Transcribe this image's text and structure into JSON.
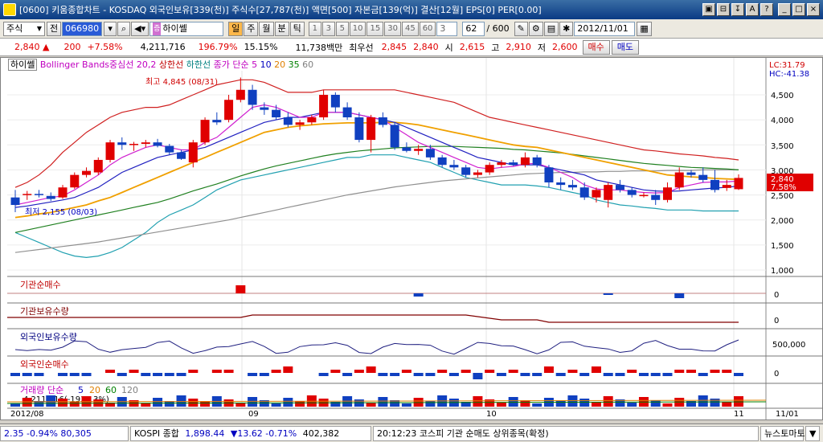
{
  "window": {
    "title": "[0600] 키움종합차트 - KOSDAQ 외국인보유[339(천)] 주식수[27,787(천)] 액면[500] 자본금[139(억)] 결산[12월] EPS[0] PER[0.00]"
  },
  "toolbar": {
    "market": "주식",
    "market_scope": "전",
    "code": "066980",
    "stock_name": "하이쎌",
    "period_buttons": [
      "일",
      "주",
      "월",
      "분",
      "틱"
    ],
    "active_period": "일",
    "minute_buttons": [
      "1",
      "3",
      "5",
      "10",
      "15",
      "30",
      "45",
      "60"
    ],
    "spin_value": "3",
    "count_value": "62",
    "count_total": "/ 600",
    "date": "2012/11/01"
  },
  "quote": {
    "price": "2,840",
    "change": "200",
    "change_pct": "+7.58%",
    "volume": "4,211,716",
    "volume_ratio": "196.79%",
    "turnover": "15.15%",
    "amount": "11,738백만",
    "best_label": "최우선",
    "ask": "2,845",
    "bid": "2,840",
    "open_label": "시",
    "open": "2,615",
    "high_label": "고",
    "high": "2,910",
    "low_label": "저",
    "low": "2,600",
    "sell_button": "매수",
    "buy_button": "매도"
  },
  "legend": {
    "name": "하이쎌",
    "bb": "Bollinger Bands중심선 20,2",
    "upper": "상한선",
    "lower": "하한선",
    "ma_title": "종가 단순",
    "ma_periods": [
      "5",
      "10",
      "20",
      "35",
      "60"
    ]
  },
  "main_chart": {
    "lc_label": "LC:31.79",
    "hc_label": "HC:-41.38",
    "high_note": "최고 4,845 (08/31)",
    "low_note": "최저 2,155 (08/03)",
    "current_price_tag": "2,840",
    "current_pct_tag": "7.58%",
    "y_ticks": [
      "4,500",
      "4,000",
      "3,500",
      "3,000",
      "2,500",
      "2,000",
      "1,500",
      "1,000"
    ]
  },
  "panels": [
    {
      "title": "기관순매수",
      "tick": "0"
    },
    {
      "title": "기관보유수량",
      "tick": "0"
    },
    {
      "title": "외국인보유수량",
      "tick": "500,000"
    },
    {
      "title": "외국인순매수",
      "tick": "0"
    },
    {
      "title": "거래량 단순",
      "periods": [
        "5",
        "20",
        "60",
        "120"
      ],
      "sub": "4,211,716(-193.13%)"
    }
  ],
  "x_axis": [
    "2012/08",
    "09",
    "10",
    "11",
    "11/01"
  ],
  "chart_data": {
    "type": "candlestick",
    "days": 62,
    "ohlc": [
      [
        2450,
        2600,
        2155,
        2300
      ],
      [
        2500,
        2580,
        2400,
        2520
      ],
      [
        2520,
        2600,
        2450,
        2500
      ],
      [
        2480,
        2550,
        2380,
        2420
      ],
      [
        2450,
        2700,
        2420,
        2650
      ],
      [
        2650,
        2950,
        2620,
        2900
      ],
      [
        2900,
        3050,
        2850,
        2980
      ],
      [
        2950,
        3250,
        2900,
        3200
      ],
      [
        3200,
        3600,
        3150,
        3550
      ],
      [
        3550,
        3650,
        3400,
        3500
      ],
      [
        3500,
        3560,
        3380,
        3520
      ],
      [
        3520,
        3600,
        3450,
        3550
      ],
      [
        3550,
        3620,
        3450,
        3480
      ],
      [
        3480,
        3520,
        3300,
        3350
      ],
      [
        3350,
        3400,
        3200,
        3220
      ],
      [
        3150,
        3600,
        3050,
        3550
      ],
      [
        3550,
        4050,
        3500,
        4000
      ],
      [
        4000,
        4150,
        3900,
        3950
      ],
      [
        4000,
        4500,
        3950,
        4400
      ],
      [
        4400,
        4845,
        4350,
        4600
      ],
      [
        4600,
        4700,
        4200,
        4300
      ],
      [
        4250,
        4350,
        4100,
        4200
      ],
      [
        4200,
        4300,
        4000,
        4050
      ],
      [
        4050,
        4150,
        3850,
        3900
      ],
      [
        3900,
        4000,
        3800,
        3950
      ],
      [
        3950,
        4100,
        3900,
        4050
      ],
      [
        4050,
        4600,
        4000,
        4500
      ],
      [
        4500,
        4550,
        4150,
        4250
      ],
      [
        4250,
        4350,
        4000,
        4050
      ],
      [
        4050,
        4150,
        3550,
        3600
      ],
      [
        3600,
        4100,
        3350,
        4050
      ],
      [
        4050,
        4150,
        3850,
        3900
      ],
      [
        3900,
        3950,
        3400,
        3450
      ],
      [
        3450,
        3550,
        3350,
        3380
      ],
      [
        3380,
        3500,
        3300,
        3420
      ],
      [
        3420,
        3500,
        3200,
        3250
      ],
      [
        3250,
        3300,
        3050,
        3100
      ],
      [
        3100,
        3200,
        3000,
        3050
      ],
      [
        3050,
        3100,
        2850,
        2900
      ],
      [
        2900,
        3000,
        2850,
        2950
      ],
      [
        2950,
        3150,
        2900,
        3100
      ],
      [
        3100,
        3200,
        3050,
        3150
      ],
      [
        3150,
        3200,
        3080,
        3100
      ],
      [
        3100,
        3350,
        3050,
        3250
      ],
      [
        3250,
        3300,
        3050,
        3100
      ],
      [
        3050,
        3100,
        2650,
        2750
      ],
      [
        2750,
        2850,
        2600,
        2700
      ],
      [
        2700,
        2800,
        2600,
        2650
      ],
      [
        2650,
        2750,
        2400,
        2450
      ],
      [
        2450,
        2650,
        2350,
        2600
      ],
      [
        2400,
        2750,
        2250,
        2700
      ],
      [
        2700,
        2800,
        2550,
        2600
      ],
      [
        2600,
        2650,
        2450,
        2500
      ],
      [
        2500,
        2550,
        2450,
        2500
      ],
      [
        2500,
        2600,
        2300,
        2400
      ],
      [
        2400,
        2750,
        2350,
        2650
      ],
      [
        2650,
        3050,
        2600,
        2950
      ],
      [
        2950,
        3000,
        2850,
        2900
      ],
      [
        2900,
        3050,
        2750,
        2800
      ],
      [
        2800,
        3000,
        2550,
        2600
      ],
      [
        2640,
        2800,
        2580,
        2700
      ],
      [
        2615,
        2910,
        2600,
        2840
      ]
    ],
    "bb_upper": [
      2650,
      2750,
      2900,
      3100,
      3350,
      3550,
      3750,
      3900,
      4050,
      4150,
      4200,
      4250,
      4250,
      4300,
      4400,
      4500,
      4600,
      4700,
      4750,
      4800,
      4800,
      4750,
      4650,
      4550,
      4550,
      4550,
      4600,
      4600,
      4600,
      4600,
      4600,
      4600,
      4600,
      4550,
      4500,
      4450,
      4400,
      4350,
      4250,
      4150,
      4050,
      4000,
      3950,
      3900,
      3850,
      3800,
      3750,
      3700,
      3650,
      3600,
      3550,
      3500,
      3450,
      3400,
      3380,
      3350,
      3320,
      3300,
      3280,
      3250,
      3230,
      3200
    ],
    "bb_lower": [
      1750,
      1650,
      1550,
      1450,
      1350,
      1280,
      1250,
      1280,
      1350,
      1450,
      1600,
      1750,
      1950,
      2100,
      2200,
      2300,
      2450,
      2600,
      2700,
      2800,
      2850,
      2900,
      2950,
      3000,
      3050,
      3100,
      3150,
      3200,
      3250,
      3250,
      3300,
      3300,
      3300,
      3250,
      3200,
      3150,
      3050,
      2950,
      2850,
      2800,
      2750,
      2700,
      2700,
      2700,
      2680,
      2650,
      2600,
      2550,
      2500,
      2400,
      2350,
      2300,
      2280,
      2250,
      2230,
      2200,
      2200,
      2200,
      2180,
      2180,
      2180,
      2180
    ],
    "ma5": [
      2300,
      2350,
      2400,
      2450,
      2480,
      2600,
      2750,
      2900,
      3100,
      3250,
      3350,
      3450,
      3500,
      3450,
      3400,
      3400,
      3550,
      3650,
      3850,
      4050,
      4250,
      4300,
      4250,
      4150,
      4050,
      4050,
      4150,
      4150,
      4150,
      4100,
      4050,
      4000,
      3850,
      3700,
      3550,
      3450,
      3350,
      3250,
      3150,
      3050,
      3020,
      3050,
      3070,
      3120,
      3130,
      3050,
      2950,
      2850,
      2700,
      2620,
      2600,
      2600,
      2570,
      2550,
      2540,
      2550,
      2650,
      2700,
      2750,
      2760,
      2760,
      2780
    ],
    "ma10": [
      2250,
      2280,
      2320,
      2360,
      2400,
      2450,
      2550,
      2650,
      2800,
      2950,
      3050,
      3150,
      3250,
      3300,
      3350,
      3400,
      3450,
      3550,
      3650,
      3750,
      3850,
      3950,
      4000,
      4050,
      4050,
      4100,
      4150,
      4150,
      4150,
      4100,
      4050,
      4000,
      3950,
      3850,
      3750,
      3650,
      3550,
      3450,
      3350,
      3250,
      3200,
      3150,
      3100,
      3100,
      3100,
      3050,
      3000,
      2950,
      2900,
      2800,
      2750,
      2700,
      2650,
      2600,
      2580,
      2570,
      2580,
      2600,
      2620,
      2640,
      2650,
      2680
    ],
    "ma20": [
      2050,
      2080,
      2120,
      2150,
      2200,
      2250,
      2300,
      2380,
      2450,
      2550,
      2650,
      2750,
      2850,
      2950,
      3050,
      3150,
      3250,
      3350,
      3450,
      3550,
      3650,
      3750,
      3800,
      3850,
      3880,
      3900,
      3920,
      3930,
      3940,
      3940,
      3940,
      3950,
      3950,
      3930,
      3900,
      3850,
      3800,
      3750,
      3700,
      3650,
      3600,
      3550,
      3500,
      3470,
      3450,
      3400,
      3350,
      3300,
      3250,
      3200,
      3150,
      3100,
      3050,
      3000,
      2950,
      2900,
      2880,
      2860,
      2850,
      2830,
      2820,
      2810
    ],
    "ma35": [
      1750,
      1800,
      1850,
      1900,
      1950,
      2000,
      2050,
      2100,
      2150,
      2200,
      2250,
      2300,
      2350,
      2420,
      2500,
      2580,
      2650,
      2720,
      2800,
      2880,
      2950,
      3020,
      3080,
      3130,
      3180,
      3230,
      3280,
      3320,
      3350,
      3380,
      3400,
      3420,
      3440,
      3450,
      3460,
      3470,
      3470,
      3470,
      3460,
      3450,
      3440,
      3430,
      3410,
      3400,
      3380,
      3360,
      3340,
      3310,
      3280,
      3250,
      3220,
      3190,
      3160,
      3130,
      3110,
      3090,
      3070,
      3050,
      3040,
      3030,
      3020,
      3000
    ],
    "ma60": [
      1350,
      1380,
      1410,
      1440,
      1470,
      1500,
      1530,
      1560,
      1600,
      1640,
      1680,
      1720,
      1760,
      1800,
      1840,
      1880,
      1920,
      1960,
      2000,
      2050,
      2100,
      2150,
      2200,
      2250,
      2300,
      2350,
      2400,
      2450,
      2500,
      2540,
      2580,
      2620,
      2660,
      2690,
      2720,
      2750,
      2780,
      2800,
      2820,
      2840,
      2860,
      2880,
      2900,
      2920,
      2930,
      2940,
      2950,
      2950,
      2960,
      2960,
      2970,
      2970,
      2980,
      2980,
      2980,
      2990,
      2990,
      2990,
      3000,
      3000,
      3000,
      3000
    ],
    "inst_net": [
      0,
      0,
      0,
      0,
      0,
      0,
      0,
      0,
      0,
      0,
      0,
      0,
      0,
      0,
      0,
      0,
      0,
      0,
      0,
      5,
      0,
      0,
      0,
      0,
      0,
      0,
      0,
      0,
      0,
      0,
      0,
      0,
      0,
      0,
      0,
      0,
      0,
      0,
      0,
      0,
      0,
      0,
      0,
      0,
      0,
      0,
      0,
      0,
      0,
      0,
      0,
      0,
      0,
      0,
      0,
      0,
      0,
      0,
      0,
      0,
      0,
      0
    ],
    "foreign_net": [
      -1,
      -1,
      -1,
      0,
      -1,
      -1,
      -1,
      0,
      1,
      -1,
      1,
      -1,
      -1,
      -1,
      -1,
      1,
      0,
      1,
      1,
      0,
      -1,
      -1,
      1,
      2,
      0,
      0,
      -1,
      1,
      -1,
      1,
      2,
      -1,
      -1,
      1,
      -1,
      -1,
      1,
      -1,
      1,
      -2,
      1,
      -1,
      1,
      -1,
      -1,
      2,
      -1,
      1,
      -1,
      2,
      -1,
      -1,
      1,
      -1,
      -1,
      -1,
      1,
      1,
      -1,
      1,
      1,
      -1
    ]
  },
  "status": {
    "index_a": "2.35 -0.94% 80,305",
    "kospi_label": "KOSPI 종합",
    "kospi": "1,898.44",
    "kospi_chg": "▼13.62 -0.71%",
    "kospi_vol": "402,382",
    "ticker": "20:12:23 코스피 기관 순매도 상위종목(확정)",
    "news": "뉴스토마토"
  }
}
